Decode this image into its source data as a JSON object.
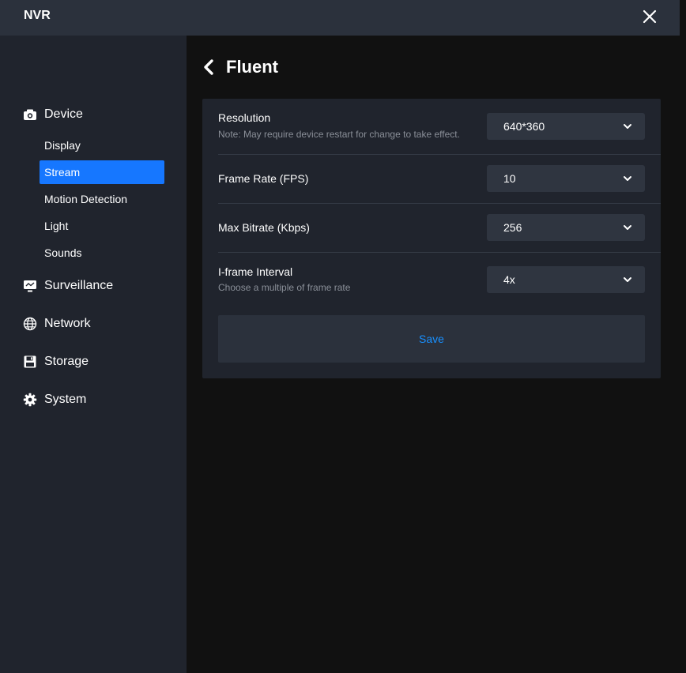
{
  "app": {
    "title": "NVR"
  },
  "sidebar": {
    "sections": [
      {
        "label": "Device",
        "icon": "camera-icon"
      },
      {
        "label": "Surveillance",
        "icon": "monitor-icon"
      },
      {
        "label": "Network",
        "icon": "globe-icon"
      },
      {
        "label": "Storage",
        "icon": "floppy-disk-icon"
      },
      {
        "label": "System",
        "icon": "gear-icon"
      }
    ],
    "device_items": [
      {
        "label": "Display",
        "active": false
      },
      {
        "label": "Stream",
        "active": true
      },
      {
        "label": "Motion Detection",
        "active": false
      },
      {
        "label": "Light",
        "active": false
      },
      {
        "label": "Sounds",
        "active": false
      }
    ]
  },
  "main": {
    "title": "Fluent",
    "settings": [
      {
        "label": "Resolution",
        "note": "Note: May require device restart for change to take effect.",
        "value": "640*360"
      },
      {
        "label": "Frame Rate (FPS)",
        "note": "",
        "value": "10"
      },
      {
        "label": "Max Bitrate (Kbps)",
        "note": "",
        "value": "256"
      },
      {
        "label": "I-frame Interval",
        "note": "Choose a multiple of frame rate",
        "value": "4x"
      }
    ],
    "save_label": "Save"
  },
  "colors": {
    "accent": "#1677ff",
    "link": "#1890ff",
    "sidebar_bg": "#20242d",
    "titlebar_bg": "#2b313c",
    "main_bg": "#111111"
  }
}
